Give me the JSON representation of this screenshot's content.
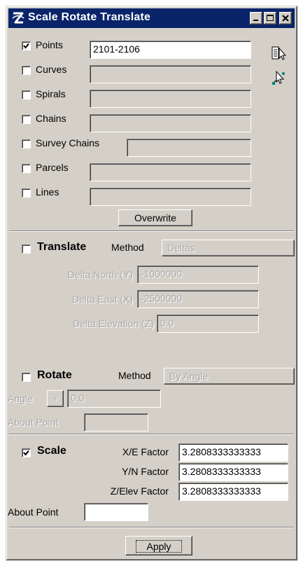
{
  "window": {
    "title": "Scale Rotate Translate",
    "minimize_icon": "minimize-icon",
    "maximize_icon": "maximize-icon",
    "close_icon": "close-icon",
    "app_icon": "geopak-logo-icon"
  },
  "selection": {
    "items": [
      {
        "label": "Points",
        "checked": true,
        "value": "2101-2106",
        "enabled": true
      },
      {
        "label": "Curves",
        "checked": false,
        "value": "",
        "enabled": false
      },
      {
        "label": "Spirals",
        "checked": false,
        "value": "",
        "enabled": false
      },
      {
        "label": "Chains",
        "checked": false,
        "value": "",
        "enabled": false
      },
      {
        "label": "Survey Chains",
        "checked": false,
        "value": "",
        "enabled": false
      },
      {
        "label": "Parcels",
        "checked": false,
        "value": "",
        "enabled": false
      },
      {
        "label": "Lines",
        "checked": false,
        "value": "",
        "enabled": false
      }
    ],
    "overwrite_label": "Overwrite",
    "side_icons": [
      "select-element-icon",
      "identify-point-icon"
    ]
  },
  "translate": {
    "label": "Translate",
    "checked": false,
    "method_label": "Method",
    "method_value": "Deltas",
    "fields": [
      {
        "label": "Delta North (Y)",
        "value": "-1000000"
      },
      {
        "label": "Delta East (X)",
        "value": "-2500000"
      },
      {
        "label": "Delta Elevation (Z)",
        "value": "0.0"
      }
    ]
  },
  "rotate": {
    "label": "Rotate",
    "checked": false,
    "method_label": "Method",
    "method_value": "By Angle",
    "angle_label": "Angle",
    "angle_sign": "+",
    "angle_value": "0.0",
    "about_point_label": "About Point",
    "about_point_value": ""
  },
  "scale": {
    "label": "Scale",
    "checked": true,
    "fields": [
      {
        "label": "X/E Factor",
        "value": "3.2808333333333"
      },
      {
        "label": "Y/N Factor",
        "value": "3.2808333333333"
      },
      {
        "label": "Z/Elev Factor",
        "value": "3.2808333333333"
      }
    ],
    "about_point_label": "About Point",
    "about_point_value": ""
  },
  "apply_label": "Apply"
}
